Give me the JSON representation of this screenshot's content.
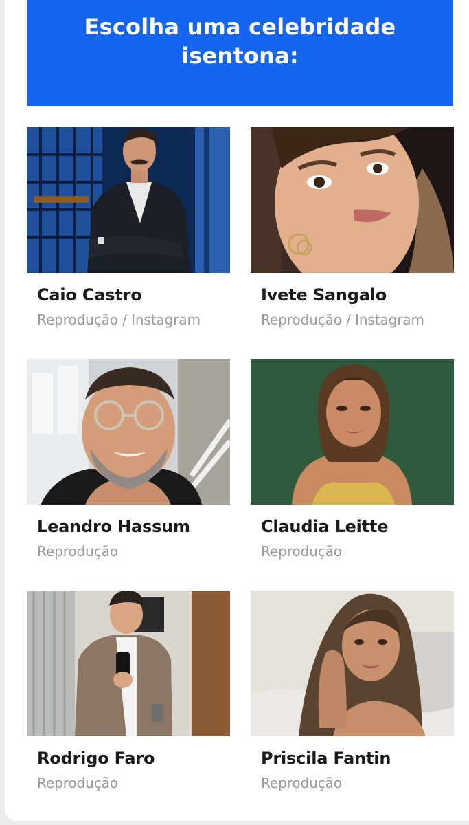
{
  "header": {
    "title": "Escolha uma celebridade isentona:"
  },
  "celebrities": [
    {
      "name": "Caio Castro",
      "credit": "Reprodução / Instagram"
    },
    {
      "name": "Ivete Sangalo",
      "credit": "Reprodução / Instagram"
    },
    {
      "name": "Leandro Hassum",
      "credit": "Reprodução"
    },
    {
      "name": "Claudia Leitte",
      "credit": "Reprodução"
    },
    {
      "name": "Rodrigo Faro",
      "credit": "Reprodução"
    },
    {
      "name": "Priscila Fantin",
      "credit": "Reprodução"
    }
  ],
  "colors": {
    "header_bg": "#1565f0",
    "name_text": "#1a1a1a",
    "credit_text": "#9a9a9a"
  }
}
